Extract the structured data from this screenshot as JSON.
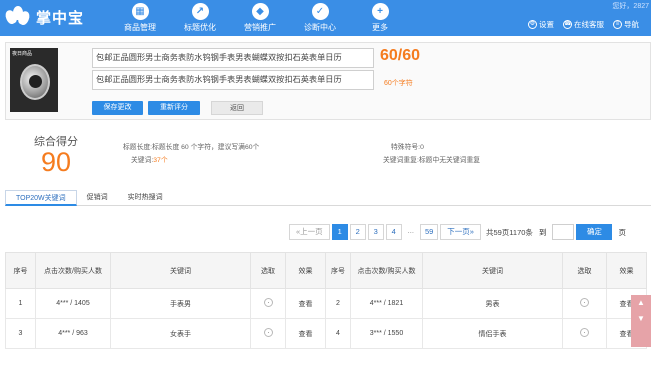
{
  "app": {
    "name": "掌中宝",
    "colors": {
      "brand": "#3a8ee6",
      "accent": "#f57c1f",
      "link": "#2d6fbe"
    }
  },
  "nav": [
    {
      "label": "商品管理",
      "icon": "grid-icon"
    },
    {
      "label": "标题优化",
      "icon": "chart-line-icon"
    },
    {
      "label": "营销推广",
      "icon": "tag-icon"
    },
    {
      "label": "诊断中心",
      "icon": "shield-check-icon"
    },
    {
      "label": "更多",
      "icon": "plus-icon"
    }
  ],
  "header": {
    "greeting": "您好，2827",
    "links": [
      {
        "label": "设置",
        "icon": "settings-icon"
      },
      {
        "label": "在线客服",
        "icon": "headset-icon"
      },
      {
        "label": "导航",
        "icon": "menu-icon"
      }
    ]
  },
  "product": {
    "image_caption": "夜日商品",
    "title_line1": "包邮正品圆形男士商务表防水钨钢手表男表蝴蝶双按扣石英表单日历",
    "title_line2": "包邮正品圆形男士商务表防水钨钢手表男表蝴蝶双按扣石英表单日历",
    "char_count": "60/60",
    "char_unit": "60个字符",
    "buttons": {
      "save": "保存更改",
      "rescore": "重新评分",
      "back": "返回"
    }
  },
  "score": {
    "label": "综合得分",
    "value": "90",
    "title_length": "标题长度:标题长度 60 个字符，建议写满60个",
    "keyword_count_label": "关键词:",
    "keyword_count_value": "37个",
    "special_chars": "特殊符号:0",
    "duplicate_words": "关键词重复:标题中无关键词重复"
  },
  "tabs": [
    {
      "label": "TOP20W关键词",
      "active": true
    },
    {
      "label": "促销词",
      "active": false
    },
    {
      "label": "实时热搜词",
      "active": false
    }
  ],
  "pagination": {
    "prev": "«上一页",
    "pages": [
      "1",
      "2",
      "3",
      "4"
    ],
    "ellipsis": "...",
    "last": "59",
    "next": "下一页»",
    "total": "共59页1170条",
    "goto": "到",
    "confirm": "确定",
    "unit": "页",
    "current": "1"
  },
  "table": {
    "headers": [
      "序号",
      "点击次数/购买人数",
      "关键词",
      "选取",
      "效果",
      "序号",
      "点击次数/购买人数",
      "关键词",
      "选取",
      "效果"
    ],
    "rows": [
      {
        "left": {
          "idx": "1",
          "stats": "4***  / 1405",
          "keyword": "手表男",
          "action": "查看"
        },
        "right": {
          "idx": "2",
          "stats": "4***  / 1821",
          "keyword": "男表",
          "action": "查看"
        }
      },
      {
        "left": {
          "idx": "3",
          "stats": "4***  / 963",
          "keyword": "女表手",
          "action": "查看"
        },
        "right": {
          "idx": "4",
          "stats": "3***  / 1550",
          "keyword": "情侣手表",
          "action": "查看"
        }
      }
    ]
  }
}
